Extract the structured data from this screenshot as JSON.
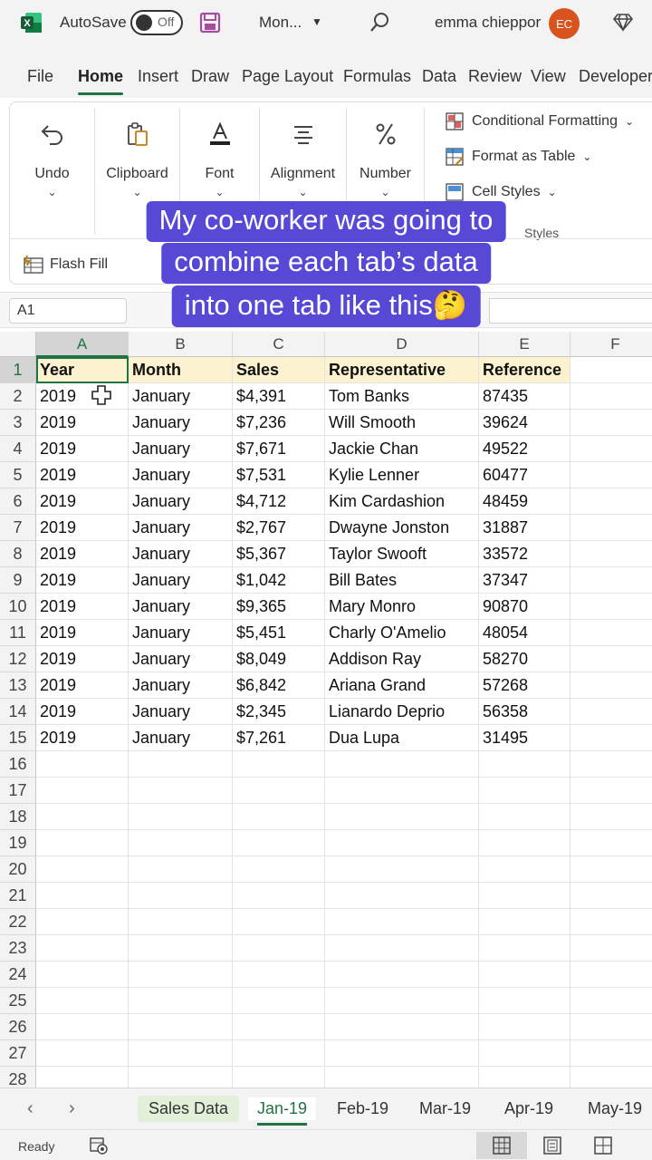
{
  "titlebar": {
    "autosave_label": "AutoSave",
    "autosave_state": "Off",
    "doc_name": "Mon...",
    "user_name": "emma chieppor",
    "user_initials": "EC",
    "brand_color": "#217346",
    "avatar_color": "#d9531e"
  },
  "ribbon_tabs": [
    "File",
    "Home",
    "Insert",
    "Draw",
    "Page Layout",
    "Formulas",
    "Data",
    "Review",
    "View",
    "Developer"
  ],
  "active_ribbon_tab": "Home",
  "ribbon": {
    "groups": [
      {
        "label": "Undo",
        "icon": "undo-icon"
      },
      {
        "label": "Clipboard",
        "icon": "clipboard-icon"
      },
      {
        "label": "Font",
        "icon": "font-icon"
      },
      {
        "label": "Alignment",
        "icon": "align-icon"
      },
      {
        "label": "Number",
        "icon": "percent-icon"
      }
    ],
    "styles_items": [
      "Conditional Formatting",
      "Format as Table",
      "Cell Styles"
    ],
    "styles_group_label": "Styles",
    "flash_fill": "Flash Fill"
  },
  "formula_bar": {
    "name_box": "A1"
  },
  "caption": {
    "lines": [
      "My co-worker was going to",
      "combine each tab’s data",
      "into one tab like this🤔"
    ]
  },
  "sheet": {
    "columns": [
      "A",
      "B",
      "C",
      "D",
      "E",
      "F"
    ],
    "selected_column": "A",
    "selected_row": "1",
    "header_row": [
      "Year",
      "Month",
      "Sales",
      "Representative",
      "Reference"
    ],
    "rows": [
      [
        "2019",
        "January",
        "$4,391",
        "Tom Banks",
        "87435"
      ],
      [
        "2019",
        "January",
        "$7,236",
        "Will Smooth",
        "39624"
      ],
      [
        "2019",
        "January",
        "$7,671",
        "Jackie Chan",
        "49522"
      ],
      [
        "2019",
        "January",
        "$7,531",
        "Kylie Lenner",
        "60477"
      ],
      [
        "2019",
        "January",
        "$4,712",
        "Kim Cardashion",
        "48459"
      ],
      [
        "2019",
        "January",
        "$2,767",
        "Dwayne Jonston",
        "31887"
      ],
      [
        "2019",
        "January",
        "$5,367",
        "Taylor Swooft",
        "33572"
      ],
      [
        "2019",
        "January",
        "$1,042",
        "Bill Bates",
        "37347"
      ],
      [
        "2019",
        "January",
        "$9,365",
        "Mary Monro",
        "90870"
      ],
      [
        "2019",
        "January",
        "$5,451",
        "Charly O'Amelio",
        "48054"
      ],
      [
        "2019",
        "January",
        "$8,049",
        "Addison Ray",
        "58270"
      ],
      [
        "2019",
        "January",
        "$6,842",
        "Ariana Grand",
        "57268"
      ],
      [
        "2019",
        "January",
        "$2,345",
        "Lianardo Deprio",
        "56358"
      ],
      [
        "2019",
        "January",
        "$7,261",
        "Dua Lupa",
        "31495"
      ]
    ],
    "row_numbers": [
      "1",
      "2",
      "3",
      "4",
      "5",
      "6",
      "7",
      "8",
      "9",
      "10",
      "11",
      "12",
      "13",
      "14",
      "15",
      "16",
      "17",
      "18",
      "19",
      "20",
      "21",
      "22",
      "23",
      "24",
      "25",
      "26",
      "27",
      "28"
    ]
  },
  "sheet_tabs": [
    "Sales Data",
    "Jan-19",
    "Feb-19",
    "Mar-19",
    "Apr-19",
    "May-19"
  ],
  "active_sheet_tab": "Jan-19",
  "status": {
    "text": "Ready"
  }
}
